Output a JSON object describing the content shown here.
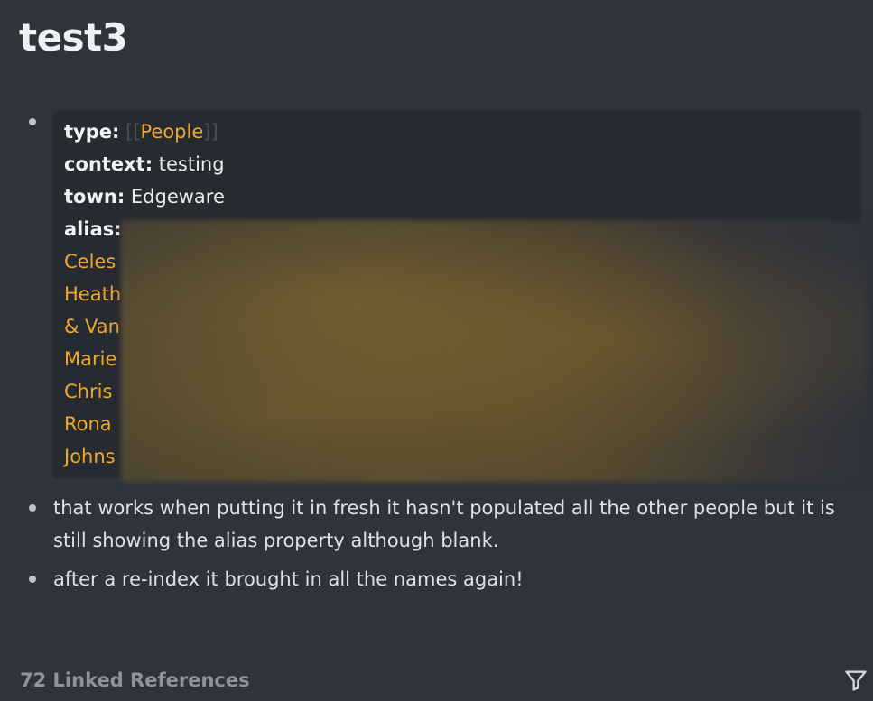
{
  "page": {
    "title": "test3"
  },
  "properties": {
    "type": {
      "key": "type:",
      "bracket_open": "[[",
      "value": "People",
      "bracket_close": "]]"
    },
    "context": {
      "key": "context:",
      "value": " testing"
    },
    "town": {
      "key": "town:",
      "value": " Edgeware"
    },
    "alias": {
      "key": "alias:",
      "visible_items": [
        "Celes",
        "Heath",
        "& Van",
        "Marie",
        "Chris",
        "Rona",
        "Johns"
      ]
    }
  },
  "blocks": [
    {
      "text": "that works when putting it in fresh it hasn't populated all the other people but it is still showing the alias property although blank."
    },
    {
      "text": "after a re-index it brought in all the names again!"
    }
  ],
  "references": {
    "label": "72 Linked References"
  },
  "icons": {
    "filter": "filter-icon",
    "bullet": "bullet-icon"
  },
  "colors": {
    "background": "#2f333b",
    "card": "#262a31",
    "page_ref": "#f2a728",
    "text": "#dfe2e6"
  }
}
